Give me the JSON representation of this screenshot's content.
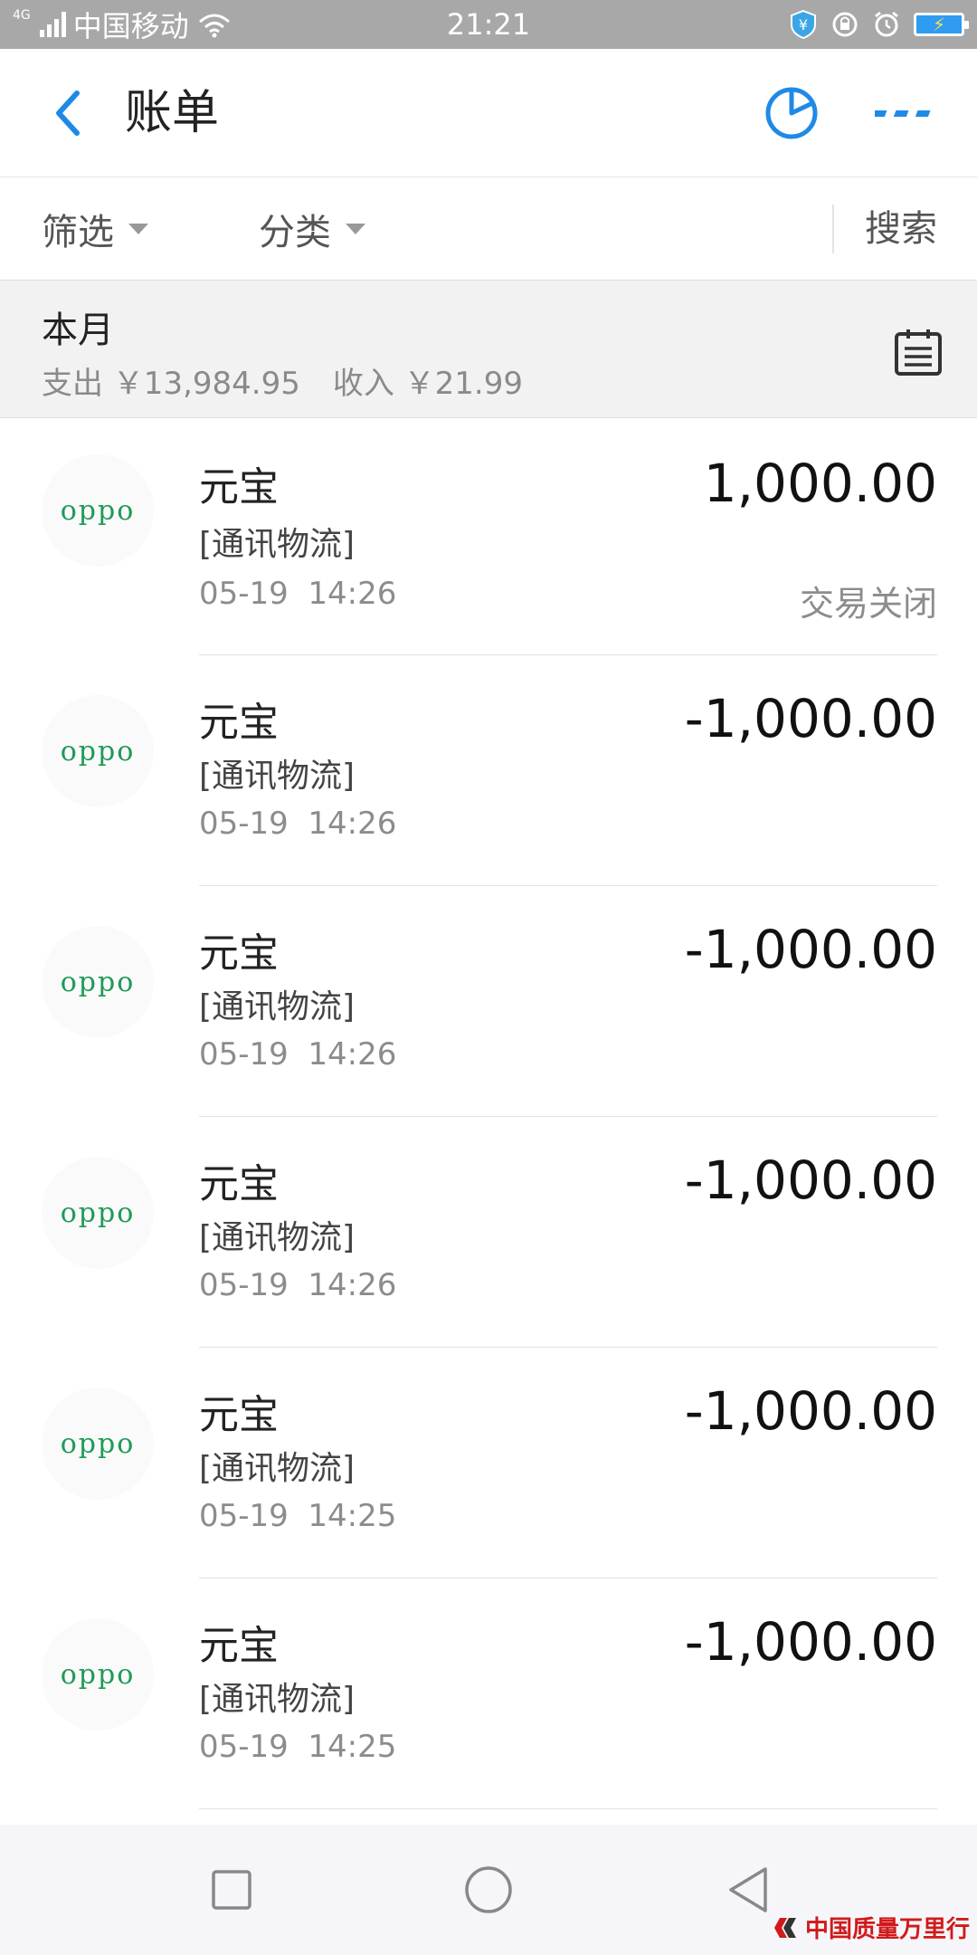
{
  "status_bar": {
    "network": "4G",
    "carrier": "中国移动",
    "time": "21:21"
  },
  "header": {
    "title": "账单"
  },
  "filter_bar": {
    "filter_label": "筛选",
    "category_label": "分类",
    "search_label": "搜索"
  },
  "month": {
    "title": "本月",
    "expense_label": "支出",
    "expense_value": "￥13,984.95",
    "income_label": "收入",
    "income_value": "￥21.99"
  },
  "bills": [
    {
      "logo": "oppo",
      "merchant": "元宝",
      "category": "[通讯物流]",
      "date": "05-19",
      "time": "14:26",
      "amount": "1,000.00",
      "status": "交易关闭"
    },
    {
      "logo": "oppo",
      "merchant": "元宝",
      "category": "[通讯物流]",
      "date": "05-19",
      "time": "14:26",
      "amount": "-1,000.00",
      "status": ""
    },
    {
      "logo": "oppo",
      "merchant": "元宝",
      "category": "[通讯物流]",
      "date": "05-19",
      "time": "14:26",
      "amount": "-1,000.00",
      "status": ""
    },
    {
      "logo": "oppo",
      "merchant": "元宝",
      "category": "[通讯物流]",
      "date": "05-19",
      "time": "14:26",
      "amount": "-1,000.00",
      "status": ""
    },
    {
      "logo": "oppo",
      "merchant": "元宝",
      "category": "[通讯物流]",
      "date": "05-19",
      "time": "14:25",
      "amount": "-1,000.00",
      "status": ""
    },
    {
      "logo": "oppo",
      "merchant": "元宝",
      "category": "[通讯物流]",
      "date": "05-19",
      "time": "14:25",
      "amount": "-1,000.00",
      "status": ""
    }
  ],
  "watermark": {
    "text": "中国质量万里行"
  },
  "colors": {
    "accent": "#1f8ae6",
    "oppo_green": "#1f9a57",
    "status_bar": "#a8a8a8",
    "watermark_red": "#d11a1a"
  },
  "icons": {
    "back": "chevron-left-icon",
    "chart": "pie-chart-icon",
    "more": "more-dots-icon",
    "calendar": "clipboard-list-icon",
    "nav_recent": "square-icon",
    "nav_home": "circle-icon",
    "nav_back": "triangle-back-icon"
  }
}
